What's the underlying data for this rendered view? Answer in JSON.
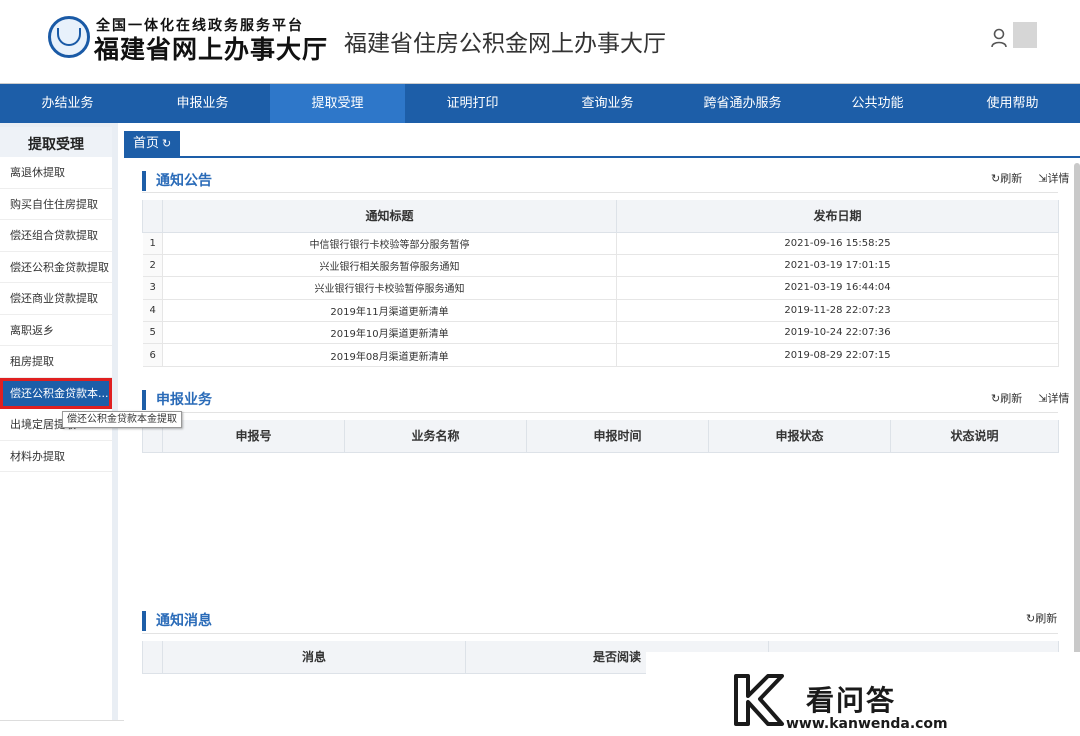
{
  "header": {
    "logo_line1": "全国一体化在线政务服务平台",
    "logo_line2": "福建省网上办事大厅",
    "site_title": "福建省住房公积金网上办事大厅"
  },
  "nav": {
    "items": [
      "办结业务",
      "申报业务",
      "提取受理",
      "证明打印",
      "查询业务",
      "跨省通办服务",
      "公共功能",
      "使用帮助"
    ],
    "active": "提取受理"
  },
  "sidebar": {
    "title": "提取受理",
    "items": [
      "离退休提取",
      "购买自住住房提取",
      "偿还组合贷款提取",
      "偿还公积金贷款提取",
      "偿还商业贷款提取",
      "离职返乡",
      "租房提取",
      "偿还公积金贷款本...",
      "出境定居提取",
      "材料办提取"
    ],
    "tooltip": "偿还公积金贷款本金提取"
  },
  "tabs": {
    "home_label": "首页"
  },
  "notice": {
    "title": "通知公告",
    "refresh_label": "刷新",
    "detail_label": "详情",
    "columns": [
      "通知标题",
      "发布日期"
    ],
    "rows": [
      {
        "no": "1",
        "title": "中信银行银行卡校验等部分服务暂停",
        "date": "2021-09-16 15:58:25"
      },
      {
        "no": "2",
        "title": "兴业银行相关服务暂停服务通知",
        "date": "2021-03-19 17:01:15"
      },
      {
        "no": "3",
        "title": "兴业银行银行卡校验暂停服务通知",
        "date": "2021-03-19 16:44:04"
      },
      {
        "no": "4",
        "title": "2019年11月渠道更新清单",
        "date": "2019-11-28 22:07:23"
      },
      {
        "no": "5",
        "title": "2019年10月渠道更新清单",
        "date": "2019-10-24 22:07:36"
      },
      {
        "no": "6",
        "title": "2019年08月渠道更新清单",
        "date": "2019-08-29 22:07:15"
      }
    ]
  },
  "declare": {
    "title": "申报业务",
    "refresh_label": "刷新",
    "detail_label": "详情",
    "columns": [
      "申报号",
      "业务名称",
      "申报时间",
      "申报状态",
      "状态说明"
    ]
  },
  "message": {
    "title": "通知消息",
    "refresh_label": "刷新",
    "columns": [
      "消息",
      "是否阅读"
    ]
  },
  "watermark": {
    "text": "看问答",
    "url": "www.kanwenda.com"
  },
  "colors": {
    "nav_bg": "#1d5ea8",
    "nav_active": "#2e77c9",
    "accent_text": "#2a6bb8",
    "highlight_border": "#e02020"
  },
  "icons": [
    "user-icon",
    "refresh-icon",
    "external-link-icon"
  ]
}
